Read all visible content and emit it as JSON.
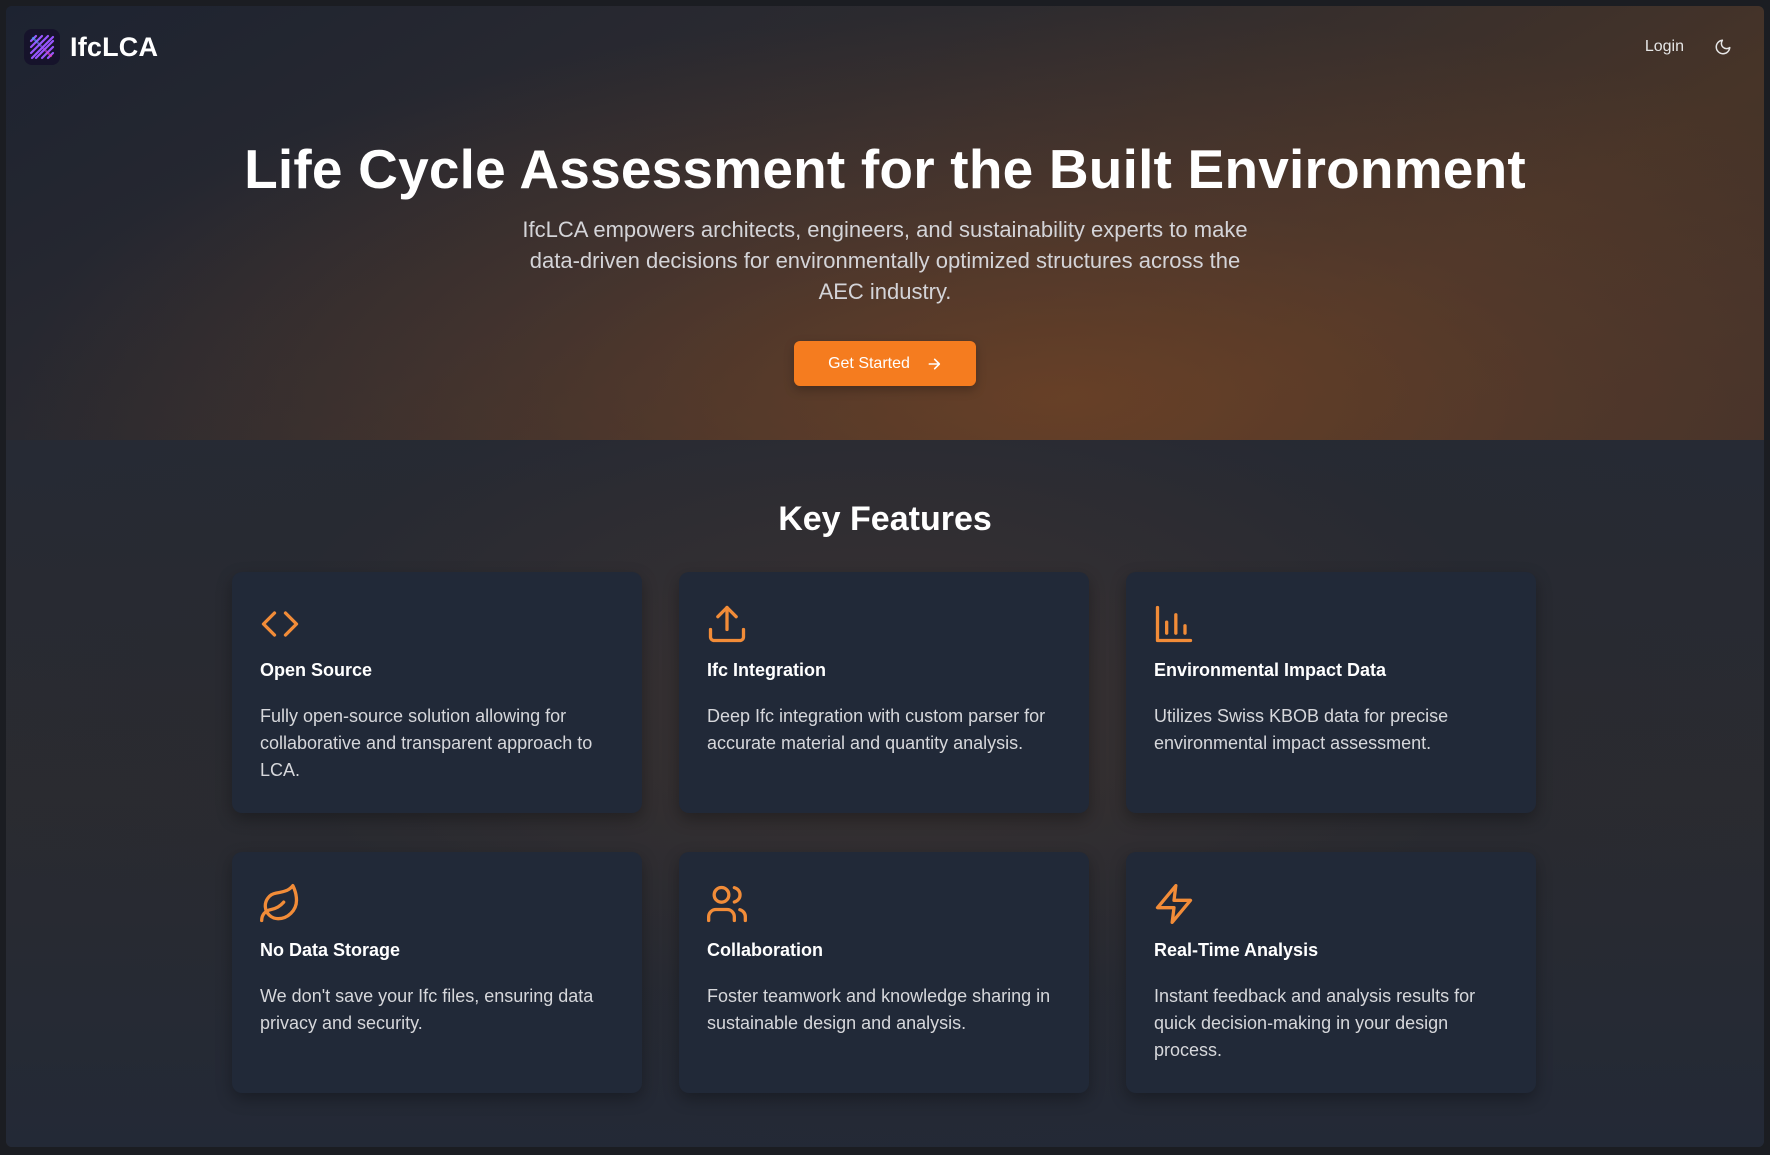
{
  "header": {
    "brand_name": "IfcLCA",
    "logo_icon": "ifclca-logo-icon",
    "login_label": "Login",
    "theme_toggle_icon": "moon-icon"
  },
  "hero": {
    "title": "Life Cycle Assessment for the Built Environment",
    "subtitle": "IfcLCA empowers architects, engineers, and sustainability experts to make data-driven decisions for environmentally optimized structures across the AEC industry.",
    "cta_label": "Get Started",
    "cta_icon": "arrow-right-icon"
  },
  "features": {
    "title": "Key Features",
    "items": [
      {
        "icon": "code-icon",
        "title": "Open Source",
        "description": "Fully open-source solution allowing for collaborative and transparent approach to LCA."
      },
      {
        "icon": "upload-icon",
        "title": "Ifc Integration",
        "description": "Deep Ifc integration with custom parser for accurate material and quantity analysis."
      },
      {
        "icon": "bar-chart-icon",
        "title": "Environmental Impact Data",
        "description": "Utilizes Swiss KBOB data for precise environmental impact assessment."
      },
      {
        "icon": "leaf-icon",
        "title": "No Data Storage",
        "description": "We don't save your Ifc files, ensuring data privacy and security."
      },
      {
        "icon": "users-icon",
        "title": "Collaboration",
        "description": "Foster teamwork and knowledge sharing in sustainable design and analysis."
      },
      {
        "icon": "zap-icon",
        "title": "Real-Time Analysis",
        "description": "Instant feedback and analysis results for quick decision-making in your design process."
      }
    ]
  },
  "colors": {
    "accent": "#f57c1f",
    "card_background": "#212938",
    "icon_color": "#f28c38"
  }
}
